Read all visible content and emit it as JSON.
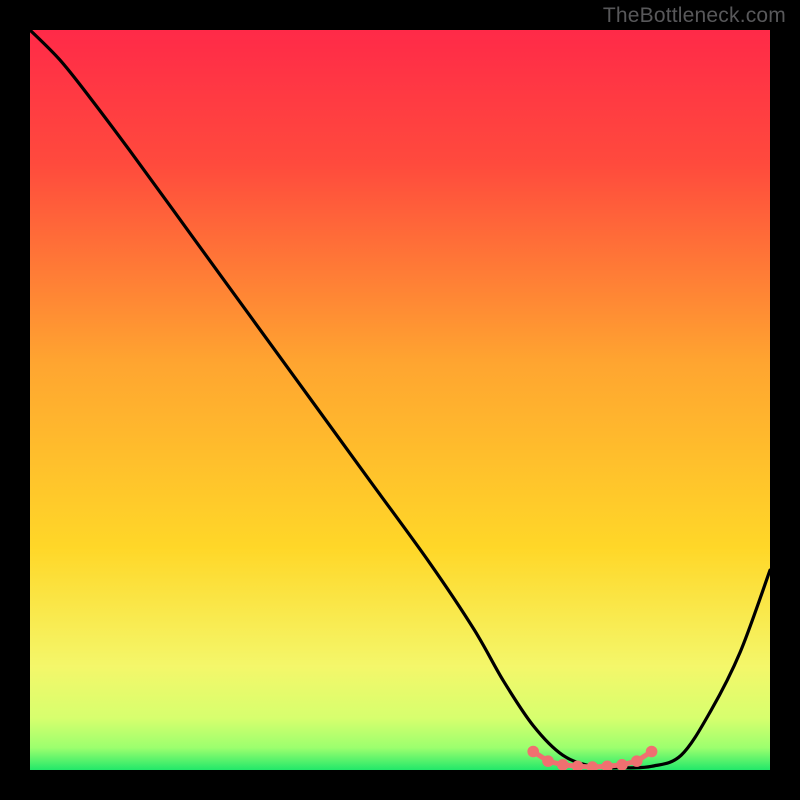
{
  "watermark": "TheBottleneck.com",
  "colors": {
    "bg": "#000000",
    "grad_top": "#ff2a48",
    "grad_mid": "#ffca28",
    "grad_low": "#e8f87a",
    "grad_green": "#2bff76",
    "curve": "#000000",
    "marker": "#f07070"
  },
  "chart_data": {
    "type": "line",
    "title": "",
    "xlabel": "",
    "ylabel": "",
    "xlim": [
      0,
      100
    ],
    "ylim": [
      0,
      100
    ],
    "series": [
      {
        "name": "bottleneck-curve",
        "x": [
          0,
          4,
          8,
          14,
          22,
          30,
          38,
          46,
          54,
          60,
          64,
          68,
          72,
          76,
          80,
          84,
          88,
          92,
          96,
          100
        ],
        "y": [
          100,
          96,
          91,
          83,
          72,
          61,
          50,
          39,
          28,
          19,
          12,
          6,
          2,
          0.5,
          0.3,
          0.5,
          2,
          8,
          16,
          27
        ]
      }
    ],
    "markers": {
      "name": "optimal-zone",
      "x": [
        68,
        70,
        72,
        74,
        76,
        78,
        80,
        82,
        84
      ],
      "y": [
        2.5,
        1.2,
        0.7,
        0.5,
        0.4,
        0.5,
        0.7,
        1.2,
        2.5
      ]
    },
    "gradient_stops": [
      {
        "pct": 0,
        "label": "red"
      },
      {
        "pct": 50,
        "label": "orange"
      },
      {
        "pct": 80,
        "label": "yellow"
      },
      {
        "pct": 97,
        "label": "pale"
      },
      {
        "pct": 100,
        "label": "green"
      }
    ]
  }
}
